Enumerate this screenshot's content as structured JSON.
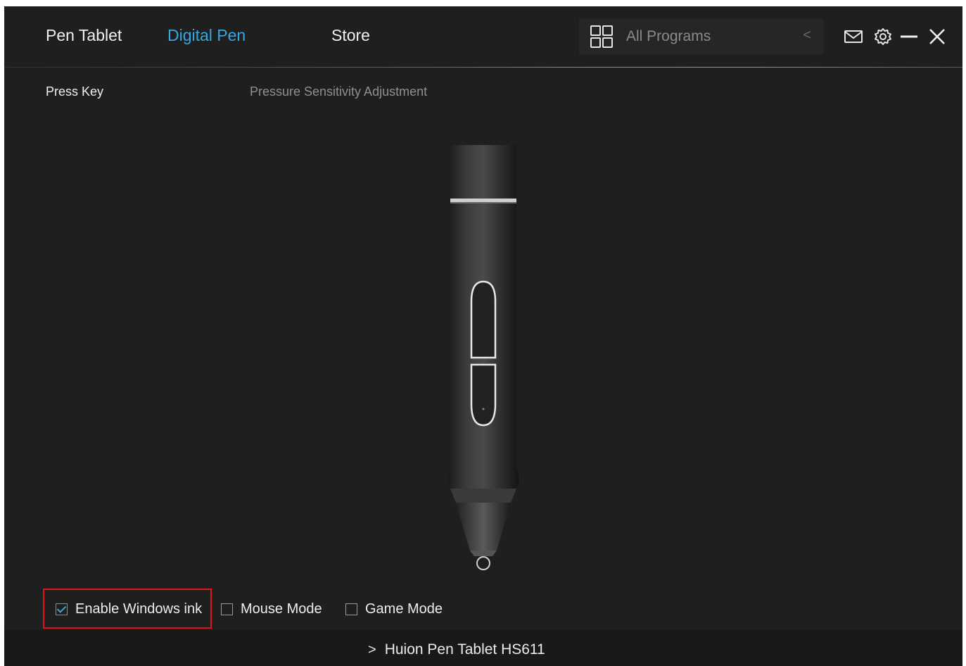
{
  "header": {
    "tabs": [
      {
        "label": "Pen Tablet",
        "active": false
      },
      {
        "label": "Digital Pen",
        "active": true
      },
      {
        "label": "Store",
        "active": false
      }
    ],
    "search": {
      "value": "All Programs",
      "icon": "grid-icon"
    },
    "icons": [
      "mail-icon",
      "gear-icon",
      "minimize-icon",
      "close-icon"
    ]
  },
  "subtabs": [
    {
      "label": "Press Key",
      "active": true
    },
    {
      "label": "Pressure Sensitivity Adjustment",
      "active": false
    }
  ],
  "options": [
    {
      "label": "Enable Windows ink",
      "checked": true
    },
    {
      "label": "Mouse Mode",
      "checked": false
    },
    {
      "label": "Game Mode",
      "checked": false
    }
  ],
  "footer": {
    "device": "Huion Pen Tablet HS611"
  },
  "colors": {
    "accent": "#35a8e0",
    "background": "#1f1f1f",
    "highlight": "#e0141e"
  }
}
